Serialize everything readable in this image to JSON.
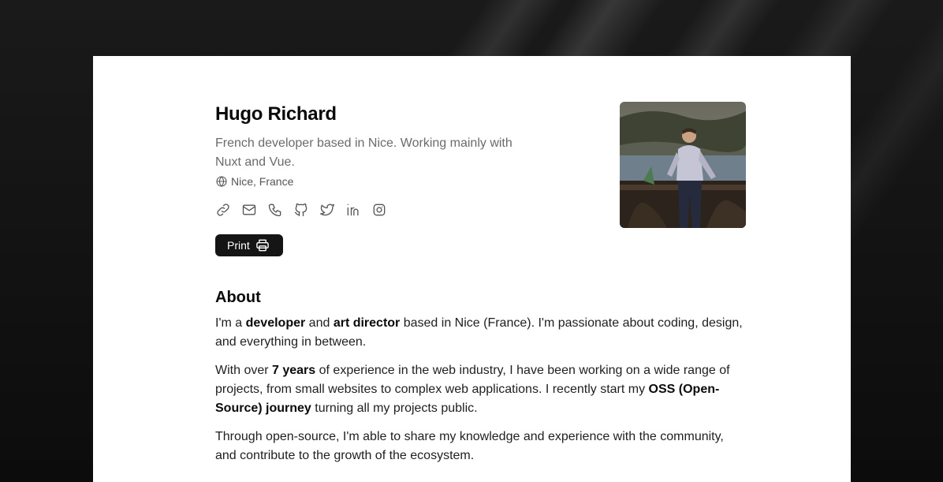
{
  "profile": {
    "name": "Hugo Richard",
    "bio": "French developer based in Nice. Working mainly with Nuxt and Vue.",
    "location": "Nice, France"
  },
  "socials": [
    {
      "icon": "link-icon"
    },
    {
      "icon": "mail-icon"
    },
    {
      "icon": "phone-icon"
    },
    {
      "icon": "github-icon"
    },
    {
      "icon": "twitter-icon"
    },
    {
      "icon": "linkedin-icon"
    },
    {
      "icon": "instagram-icon"
    }
  ],
  "print": {
    "label": "Print"
  },
  "about": {
    "title": "About",
    "p1": {
      "t1": "I'm a ",
      "b1": "developer",
      "t2": " and ",
      "b2": "art director",
      "t3": " based in Nice (France). I'm passionate about coding, design, and everything in between."
    },
    "p2": {
      "t1": "With over ",
      "b1": "7 years",
      "t2": " of experience in the web industry, I have been working on a wide range of projects, from small websites to complex web applications. I recently start my ",
      "b2": "OSS (Open-Source) journey",
      "t3": " turning all my projects public."
    },
    "p3": "Through open-source, I'm able to share my knowledge and experience with the community, and contribute to the growth of the ecosystem."
  },
  "colors": {
    "background": "#111111",
    "card": "#ffffff",
    "button": "#151515",
    "muted_text": "#6b6b6b"
  }
}
